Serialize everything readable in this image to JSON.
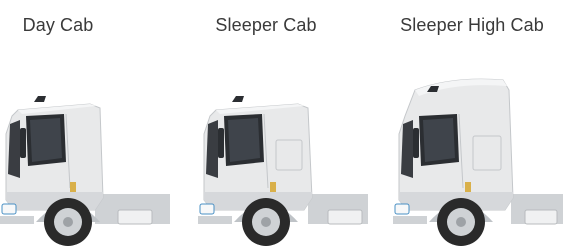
{
  "cab_options": [
    {
      "label": "Day Cab",
      "roof": "low"
    },
    {
      "label": "Sleeper Cab",
      "roof": "low"
    },
    {
      "label": "Sleeper High Cab",
      "roof": "high"
    }
  ],
  "colors": {
    "label_text": "#3a3a3a",
    "cab_body": "#e8e9ea",
    "window": "#2b2e32",
    "tire": "#2a2a2a",
    "accent_step": "#d9b04a"
  }
}
